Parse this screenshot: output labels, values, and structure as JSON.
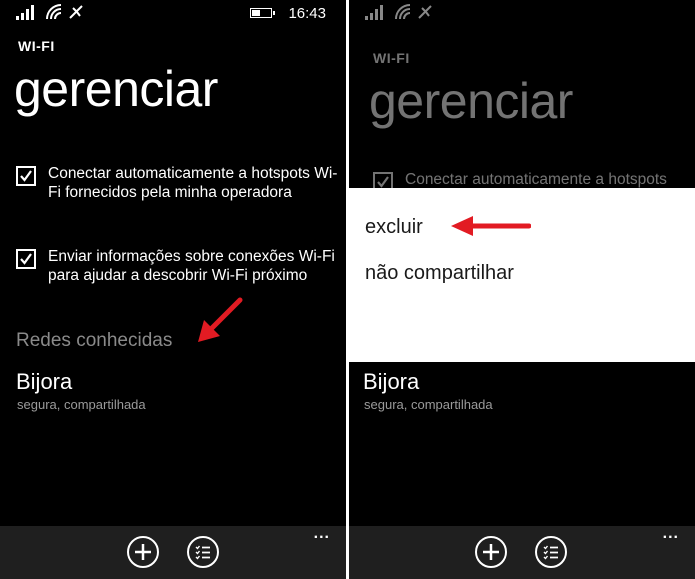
{
  "left": {
    "status": {
      "time": "16:43"
    },
    "app_title": "WI-FI",
    "page_title": "gerenciar",
    "options": [
      {
        "label": "Conectar automaticamente a hotspots Wi-Fi fornecidos pela minha operadora",
        "checked": true
      },
      {
        "label": "Enviar informações sobre conexões Wi-Fi para ajudar a descobrir Wi-Fi próximo",
        "checked": true
      }
    ],
    "section_header": "Redes conhecidas",
    "network": {
      "name": "Bijora",
      "status": "segura, compartilhada"
    },
    "appbar": {
      "icons": [
        "add-icon",
        "list-icon"
      ],
      "more": "..."
    }
  },
  "right": {
    "app_title": "WI-FI",
    "page_title": "gerenciar",
    "option_partial": "Conectar automaticamente a hotspots",
    "context_menu": [
      "excluir",
      "não compartilhar"
    ],
    "network": {
      "name": "Bijora",
      "status": "segura, compartilhada"
    },
    "appbar": {
      "icons": [
        "add-icon",
        "list-icon"
      ],
      "more": "..."
    }
  },
  "colors": {
    "background": "#000000",
    "accent_arrow": "#e21b23",
    "secondary_text": "#8a8a8a",
    "appbar": "#1f1f1f"
  }
}
